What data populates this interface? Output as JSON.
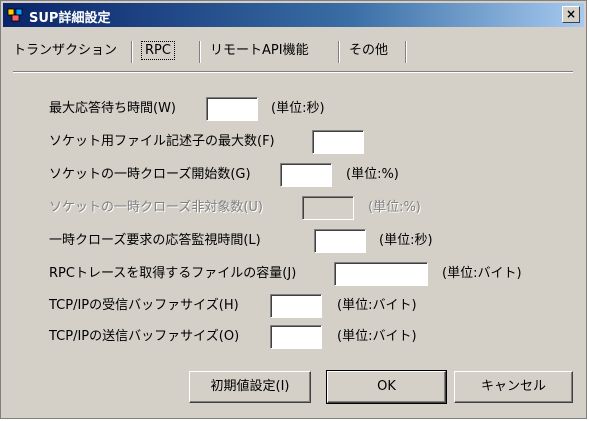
{
  "window": {
    "title": "SUP詳細設定",
    "close_label": "×"
  },
  "tabs": [
    {
      "label": "トランザクション",
      "active": false
    },
    {
      "label": "RPC",
      "active": true
    },
    {
      "label": "リモートAPI機能",
      "active": false
    },
    {
      "label": "その他",
      "active": false
    }
  ],
  "fields": [
    {
      "label": "最大応答待ち時間(W)",
      "value": "",
      "unit": "(単位:秒)",
      "enabled": true
    },
    {
      "label": "ソケット用ファイル記述子の最大数(F)",
      "value": "",
      "unit": "",
      "enabled": true
    },
    {
      "label": "ソケットの一時クローズ開始数(G)",
      "value": "",
      "unit": "(単位:%)",
      "enabled": true
    },
    {
      "label": "ソケットの一時クローズ非対象数(U)",
      "value": "",
      "unit": "(単位:%)",
      "enabled": false
    },
    {
      "label": "一時クローズ要求の応答監視時間(L)",
      "value": "",
      "unit": "(単位:秒)",
      "enabled": true
    },
    {
      "label": "RPCトレースを取得するファイルの容量(J)",
      "value": "",
      "unit": "(単位:バイト)",
      "enabled": true
    },
    {
      "label": "TCP/IPの受信バッファサイズ(H)",
      "value": "",
      "unit": "(単位:バイト)",
      "enabled": true
    },
    {
      "label": "TCP/IPの送信バッファサイズ(O)",
      "value": "",
      "unit": "(単位:バイト)",
      "enabled": true
    }
  ],
  "buttons": {
    "defaults": "初期値設定(I)",
    "ok": "OK",
    "cancel": "キャンセル"
  }
}
